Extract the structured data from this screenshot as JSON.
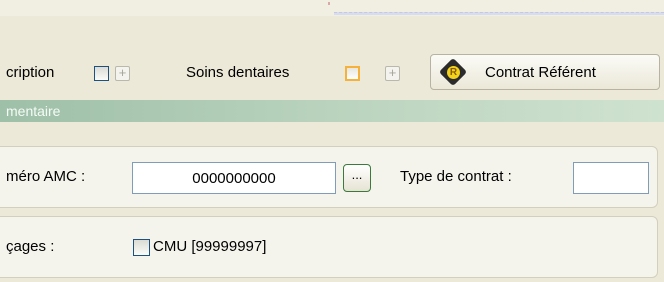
{
  "options": {
    "inscription_label": "cription",
    "soins_label": "Soins dentaires",
    "plus_symbol": "+",
    "contract_button_label": "Contrat Référent",
    "contract_badge_letter": "R"
  },
  "section": {
    "title": "mentaire"
  },
  "amc": {
    "numero_label": "méro AMC :",
    "numero_value": "0000000000",
    "browse_label": "...",
    "type_contrat_label": "Type de contrat :",
    "type_contrat_value": ""
  },
  "aiguillage": {
    "label": "çages :",
    "cmu_label": "CMU [99999997]"
  },
  "colors": {
    "section_bar": "#bfd7c2",
    "checkbox_border": "#1c5180",
    "checkbox_highlight": "#f5b13a",
    "input_border": "#7f9db9",
    "background": "#ece9d8"
  }
}
